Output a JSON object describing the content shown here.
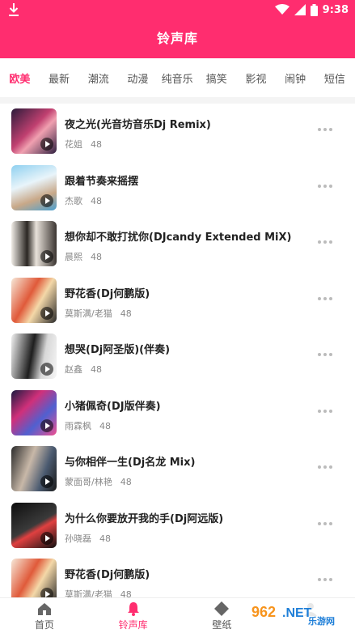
{
  "status_bar": {
    "time": "9:38"
  },
  "header": {
    "title": "铃声库"
  },
  "tabs": [
    {
      "label": "欧美",
      "active": true
    },
    {
      "label": "最新",
      "active": false
    },
    {
      "label": "潮流",
      "active": false
    },
    {
      "label": "动漫",
      "active": false
    },
    {
      "label": "纯音乐",
      "active": false
    },
    {
      "label": "搞笑",
      "active": false
    },
    {
      "label": "影视",
      "active": false
    },
    {
      "label": "闹钟",
      "active": false
    },
    {
      "label": "短信",
      "active": false
    }
  ],
  "songs": [
    {
      "title": "夜之光(光音坊音乐Dj Remix)",
      "artist": "花姐",
      "count": "48"
    },
    {
      "title": "跟着节奏来摇摆",
      "artist": "杰歌",
      "count": "48"
    },
    {
      "title": "想你却不敢打扰你(DJcandy Extended MiX)",
      "artist": "晨熙",
      "count": "48"
    },
    {
      "title": "野花香(Dj何鹏版)",
      "artist": "莫斯满/老猫",
      "count": "48"
    },
    {
      "title": "想哭(Dj阿圣版)(伴奏)",
      "artist": "赵鑫",
      "count": "48"
    },
    {
      "title": "小猪佩奇(DJ版伴奏)",
      "artist": "雨霖枫",
      "count": "48"
    },
    {
      "title": "与你相伴一生(Dj名龙 Mix)",
      "artist": "蒙面哥/林艳",
      "count": "48"
    },
    {
      "title": "为什么你要放开我的手(Dj阿远版)",
      "artist": "孙晓磊",
      "count": "48"
    },
    {
      "title": "野花香(Dj何鹏版)",
      "artist": "莫斯满/老猫",
      "count": "48"
    }
  ],
  "bottom_nav": [
    {
      "label": "首页",
      "icon": "home-icon",
      "active": false
    },
    {
      "label": "铃声库",
      "icon": "bell-icon",
      "active": true
    },
    {
      "label": "壁纸",
      "icon": "diamond-icon",
      "active": false
    },
    {
      "label": "",
      "icon": "mine-icon",
      "active": false
    }
  ],
  "colors": {
    "accent": "#ff2d6f",
    "text": "#222222",
    "muted": "#888888"
  },
  "watermark": {
    "text_main": "962",
    "text_net": ".NET",
    "text_cn": "乐游网"
  }
}
